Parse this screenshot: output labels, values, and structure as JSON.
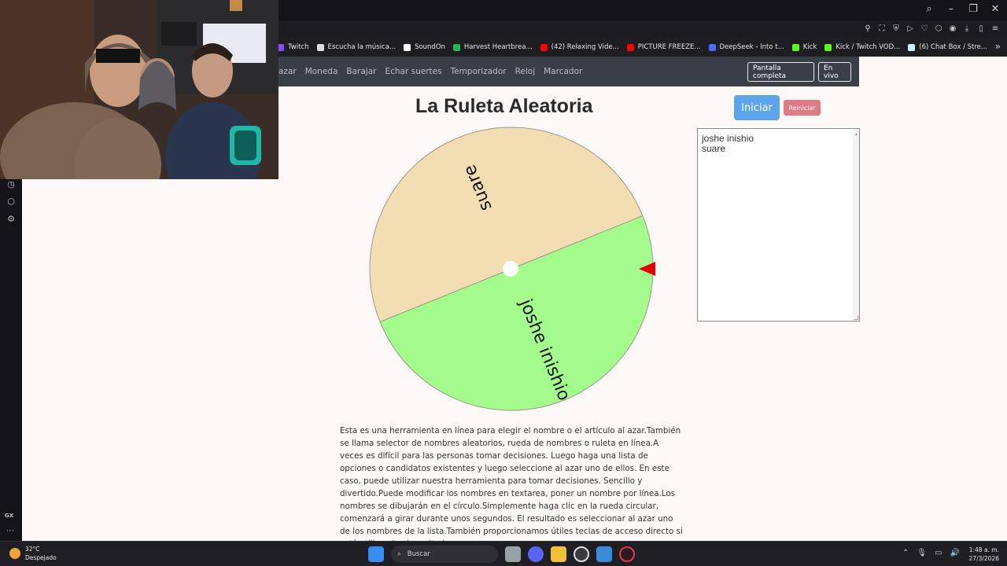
{
  "browser": {
    "bookmarks": [
      {
        "label": "Twitch",
        "color": "#9147ff"
      },
      {
        "label": "Escucha la música...",
        "color": "#dddddd"
      },
      {
        "label": "SoundOn",
        "color": "#ffffff"
      },
      {
        "label": "Harvest Heartbrea...",
        "color": "#1db954"
      },
      {
        "label": "(42) Relaxing Vide...",
        "color": "#ff0000"
      },
      {
        "label": "PICTURE FREEZE...",
        "color": "#ff0000"
      },
      {
        "label": "DeepSeek - Into t...",
        "color": "#4d6bfe"
      },
      {
        "label": "Kick",
        "color": "#53fc18"
      },
      {
        "label": "Kick / Twitch VOD...",
        "color": "#53fc18"
      },
      {
        "label": "(6) Chat Box / Stre...",
        "color": "#c9f1ff"
      }
    ],
    "more_icon": "»"
  },
  "page": {
    "nav": [
      "azar",
      "Moneda",
      "Barajar",
      "Echar suertes",
      "Temporizador",
      "Reloj",
      "Marcador"
    ],
    "fullscreen_label": "Pantalla completa",
    "live_label": "En vivo",
    "title": "La Ruleta Aleatoria",
    "start_label": "Iniciar",
    "reset_label": "Reiniciar",
    "names": [
      "joshe inishio",
      "suare"
    ],
    "description": "Esta es una herramienta en línea para elegir el nombre o el artículo al azar.También se llama selector de nombres aleatorios, rueda de nombres o ruleta en línea.A veces es difícil para las personas tomar decisiones. Luego haga una lista de opciones o candidatos existentes y luego seleccione al azar uno de ellos. En este caso, puede utilizar nuestra herramienta para tomar decisiones. Sencillo y divertido.Puede modificar los nombres en textarea, poner un nombre por línea.Los nombres se dibujarán en el círculo.Simplemente haga clic en la rueda circular, comenzará a girar durante unos segundos. El resultado es seleccionar al azar uno de los nombres de la lista.También proporcionamos útiles teclas de acceso directo si está utilizando el escritorio."
  },
  "wheel": {
    "segments": [
      {
        "name": "suare",
        "color": "#f3deb3"
      },
      {
        "name": "joshe inishio",
        "color": "#a3fc8c"
      }
    ],
    "pointer_color": "#e00000"
  },
  "sidebar": {
    "label": "GX"
  },
  "taskbar": {
    "temperature": "32°C",
    "weather": "Despejado",
    "search_label": "Buscar",
    "time": "1:48 a. m.",
    "date": "27/3/2026"
  }
}
